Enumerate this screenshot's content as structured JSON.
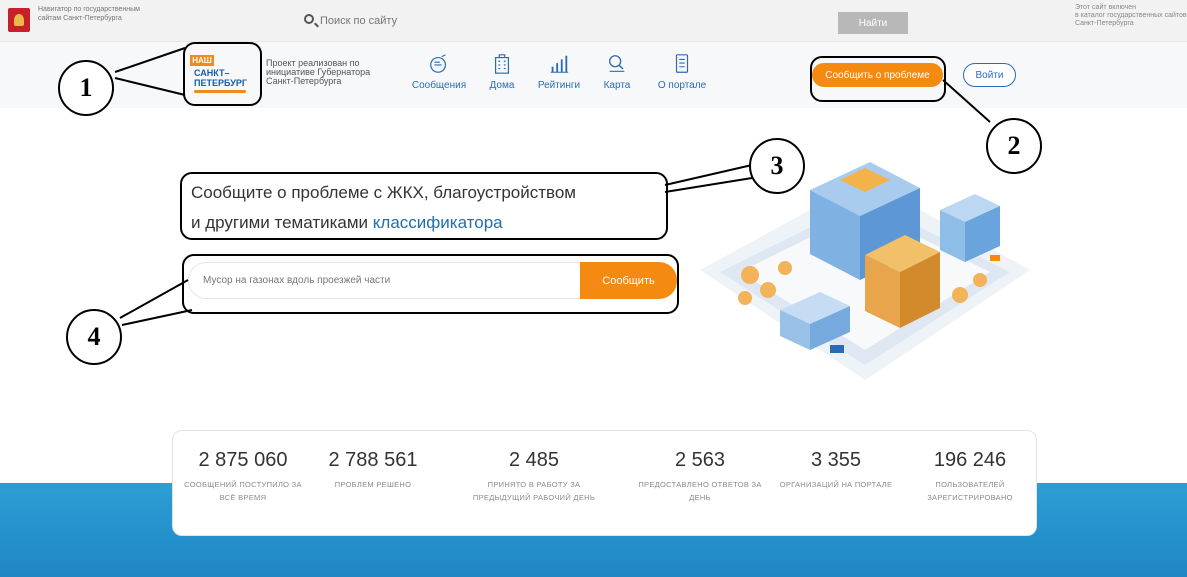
{
  "govbar": {
    "left_text": "Навигатор по государственным сайтам Санкт-Петербурга",
    "search_placeholder": "Поиск по сайту",
    "find_label": "Найти",
    "right_text_1": "Этот сайт включен",
    "right_text_2": "в каталог государственных сайтов",
    "right_text_3": "Санкт-Петербурга"
  },
  "header": {
    "logo_top": "НАШ",
    "logo_line1": "САНКТ–",
    "logo_line2": "ПЕТЕРБУРГ",
    "project_text": "Проект реализован по инициативе Губернатора Санкт-Петербурга",
    "nav": [
      {
        "label": "Сообщения",
        "icon": "chat-bubble-icon"
      },
      {
        "label": "Дома",
        "icon": "building-icon"
      },
      {
        "label": "Рейтинги",
        "icon": "bar-chart-icon"
      },
      {
        "label": "Карта",
        "icon": "map-search-icon"
      },
      {
        "label": "О портале",
        "icon": "document-icon"
      }
    ],
    "report_label": "Сообщить о проблеме",
    "login_label": "Войти"
  },
  "hero": {
    "title_line1": "Сообщите о проблеме с ЖКХ, благоустройством",
    "title_line2_prefix": "и другими тематиками ",
    "title_link": "классификатора",
    "input_placeholder": "Мусор на газонах вдоль проезжей части",
    "button_label": "Сообщить"
  },
  "annotations": [
    "1",
    "2",
    "3",
    "4"
  ],
  "stats": [
    {
      "value": "2 875 060",
      "label": "СООБЩЕНИЙ ПОСТУПИЛО ЗА ВСЁ ВРЕМЯ"
    },
    {
      "value": "2 788 561",
      "label": "ПРОБЛЕМ РЕШЕНО"
    },
    {
      "value": "2 485",
      "label": "ПРИНЯТО В РАБОТУ ЗА ПРЕДЫДУЩИЙ РАБОЧИЙ ДЕНЬ"
    },
    {
      "value": "2 563",
      "label": "ПРЕДОСТАВЛЕНО ОТВЕТОВ ЗА ДЕНЬ"
    },
    {
      "value": "3 355",
      "label": "ОРГАНИЗАЦИЙ НА ПОРТАЛЕ"
    },
    {
      "value": "196 246",
      "label": "ПОЛЬЗОВАТЕЛЕЙ ЗАРЕГИСТРИРОВАНО"
    }
  ],
  "colors": {
    "accent": "#f58a10",
    "link": "#2a6bb6",
    "band": "#1f86c4"
  }
}
